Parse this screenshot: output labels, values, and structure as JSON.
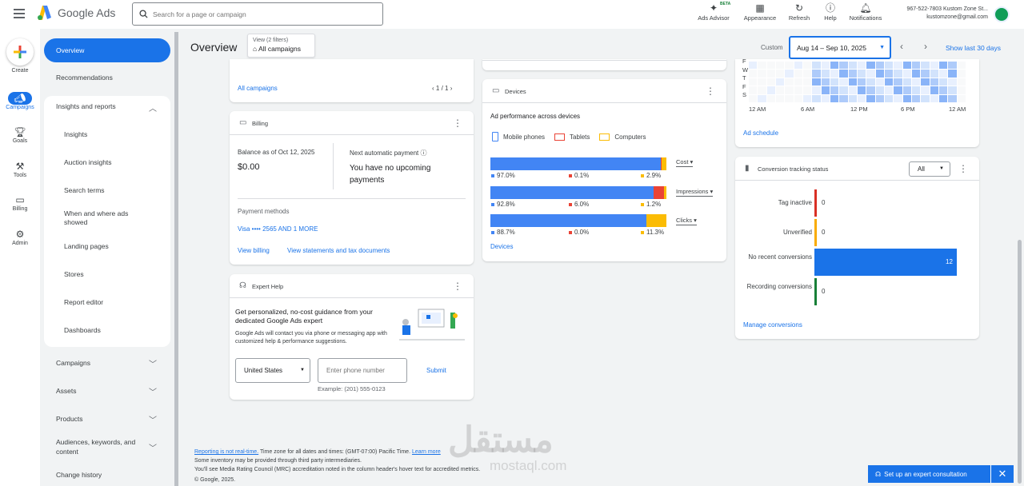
{
  "header": {
    "product_name": "Google Ads",
    "search_placeholder": "Search for a page or campaign",
    "icons": [
      {
        "label": "Ads Advisor",
        "badge": "BETA",
        "icon": "sparkle-icon"
      },
      {
        "label": "Appearance",
        "icon": "appearance-icon"
      },
      {
        "label": "Refresh",
        "icon": "refresh-icon"
      },
      {
        "label": "Help",
        "icon": "help-icon"
      },
      {
        "label": "Notifications",
        "icon": "bell-icon"
      }
    ],
    "account_id": "967-522-7803 Kustom Zone St...",
    "account_email": "kustomzone@gmail.com"
  },
  "rail": {
    "create": "Create",
    "items": [
      {
        "label": "Campaigns",
        "icon": "campaigns-icon",
        "active": true
      },
      {
        "label": "Goals",
        "icon": "trophy-icon"
      },
      {
        "label": "Tools",
        "icon": "tools-icon"
      },
      {
        "label": "Billing",
        "icon": "billing-icon"
      },
      {
        "label": "Admin",
        "icon": "gear-icon"
      }
    ]
  },
  "sidebar": {
    "overview": "Overview",
    "recommendations": "Recommendations",
    "insights_group": "Insights and reports",
    "sub_items": [
      "Insights",
      "Auction insights",
      "Search terms",
      "When and where ads showed",
      "Landing pages",
      "Stores",
      "Report editor",
      "Dashboards"
    ],
    "campaigns": "Campaigns",
    "assets": "Assets",
    "products": "Products",
    "audiences": "Audiences, keywords, and content",
    "change_history": "Change history"
  },
  "toolbar": {
    "title": "Overview",
    "view_label": "View (2 filters)",
    "view_value": "All campaigns",
    "custom": "Custom",
    "date_range": "Aug 14 – Sep 10, 2025",
    "show_last": "Show last 30 days"
  },
  "campaigns_card": {
    "link": "All campaigns",
    "pagination": "1 / 1"
  },
  "billing": {
    "title": "Billing",
    "balance_label": "Balance as of Oct 12, 2025",
    "balance": "$0.00",
    "next_payment_label": "Next automatic payment",
    "next_payment_value": "You have no upcoming payments",
    "payment_methods_label": "Payment methods",
    "payment_method": "Visa •••• 2565 AND 1 MORE",
    "view_billing": "View billing",
    "view_statements": "View statements and tax documents"
  },
  "expert_help": {
    "title": "Expert Help",
    "headline": "Get personalized, no-cost guidance from your dedicated Google Ads expert",
    "body": "Google Ads will contact you via phone or messaging app with customized help & performance suggestions.",
    "country": "United States",
    "phone_placeholder": "Enter phone number",
    "submit": "Submit",
    "example": "Example: (201) 555-0123"
  },
  "devices": {
    "title": "Devices",
    "subtitle": "Ad performance across devices",
    "legend": [
      "Mobile phones",
      "Tablets",
      "Computers"
    ],
    "colors": {
      "mobile": "#4285f4",
      "tablet": "#ea4335",
      "computer": "#fbbc04"
    },
    "rows": [
      {
        "metric": "Cost",
        "mobile": 97.0,
        "tablet": 0.1,
        "computer": 2.9,
        "labels": [
          "97.0%",
          "0.1%",
          "2.9%"
        ]
      },
      {
        "metric": "Impressions",
        "mobile": 92.8,
        "tablet": 6.0,
        "computer": 1.2,
        "labels": [
          "92.8%",
          "6.0%",
          "1.2%"
        ]
      },
      {
        "metric": "Clicks",
        "mobile": 88.7,
        "tablet": 0.0,
        "computer": 11.3,
        "labels": [
          "88.7%",
          "0.0%",
          "11.3%"
        ]
      }
    ],
    "link": "Devices"
  },
  "ad_schedule": {
    "day_labels": [
      "F",
      "W",
      "T",
      "F",
      "S"
    ],
    "hour_labels": [
      "12 AM",
      "6 AM",
      "12 PM",
      "6 PM",
      "12 AM"
    ],
    "link": "Ad schedule"
  },
  "conversion": {
    "title": "Conversion tracking status",
    "filter": "All",
    "rows": [
      {
        "label": "Tag inactive",
        "value": 0,
        "color": "#d93025"
      },
      {
        "label": "Unverified",
        "value": 0,
        "color": "#f9ab00"
      },
      {
        "label": "No recent conversions",
        "value": 12,
        "color": "#1a73e8"
      },
      {
        "label": "Recording conversions",
        "value": 0,
        "color": "#188038"
      }
    ],
    "link": "Manage conversions"
  },
  "footer": {
    "line1_link": "Reporting is not real-time.",
    "line1_text": "Time zone for all dates and times: (GMT-07:00) Pacific Time.",
    "line1_learn": "Learn more",
    "line2": "Some inventory may be provided through third party intermediaries.",
    "line3": "You'll see Media Rating Council (MRC) accreditation noted in the column header's hover text for accredited metrics.",
    "line4": "© Google, 2025."
  },
  "expert_button": "Set up an expert consultation",
  "watermark": "مستقل",
  "watermark_sub": "mostaql.com"
}
